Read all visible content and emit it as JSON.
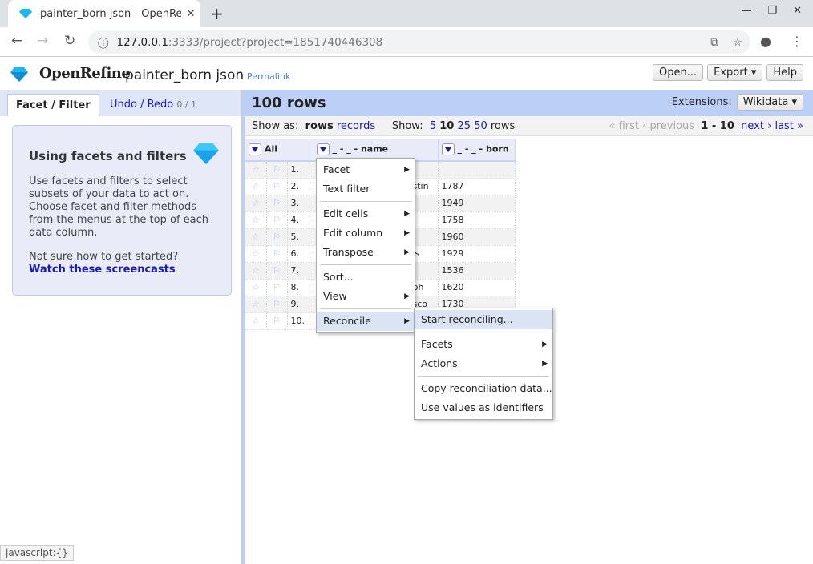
{
  "browser": {
    "tab_title": "painter_born json - OpenRefine",
    "url_host": "127.0.0.1",
    "url_path": ":3333/project?project=1851740446308",
    "new_tab": "+",
    "close": "✕"
  },
  "app": {
    "brand": "OpenRefine",
    "project": "painter_born json",
    "permalink": "Permalink",
    "buttons": {
      "open": "Open...",
      "export": "Export ▾",
      "help": "Help"
    }
  },
  "left": {
    "tab_facet": "Facet / Filter",
    "tab_undo": "Undo / Redo",
    "undo_count": "0 / 1",
    "help_title": "Using facets and filters",
    "help_text": "Use facets and filters to select subsets of your data to act on. Choose facet and filter methods from the menus at the top of each data column.",
    "help_q": "Not sure how to get started?",
    "help_link": "Watch these screencasts"
  },
  "main": {
    "rows_count": "100 rows",
    "extensions_label": "Extensions:",
    "extensions_btn": "Wikidata ▾",
    "show_as": "Show as:",
    "rows": "rows",
    "records": "records",
    "show": "Show:",
    "sizes": [
      "5",
      "10",
      "25",
      "50"
    ],
    "rows_suffix": "rows",
    "first": "« first",
    "previous": "‹ previous",
    "range": "1 - 10",
    "next": "next ›",
    "last": "last »",
    "columns": [
      "All",
      "_ - _ - name",
      "_ - _ - born"
    ],
    "rows_data": [
      {
        "n": "1.",
        "name": "",
        "born": ""
      },
      {
        "n": "2.",
        "name": "stin",
        "born": "1787"
      },
      {
        "n": "3.",
        "name": "",
        "born": "1949"
      },
      {
        "n": "4.",
        "name": "",
        "born": "1758"
      },
      {
        "n": "5.",
        "name": "",
        "born": "1960"
      },
      {
        "n": "6.",
        "name": "is",
        "born": "1929"
      },
      {
        "n": "7.",
        "name": "",
        "born": "1536"
      },
      {
        "n": "8.",
        "name": "ph",
        "born": "1620"
      },
      {
        "n": "9.",
        "name": "sco",
        "born": "1730"
      },
      {
        "n": "10.",
        "name": "",
        "born": ""
      }
    ]
  },
  "menu": [
    "Facet",
    "Text filter",
    "Edit cells",
    "Edit column",
    "Transpose",
    "Sort...",
    "View",
    "Reconcile"
  ],
  "submenu": [
    "Start reconciling...",
    "Facets",
    "Actions",
    "Copy reconciliation data...",
    "Use values as identifiers"
  ],
  "status": "javascript:{}"
}
